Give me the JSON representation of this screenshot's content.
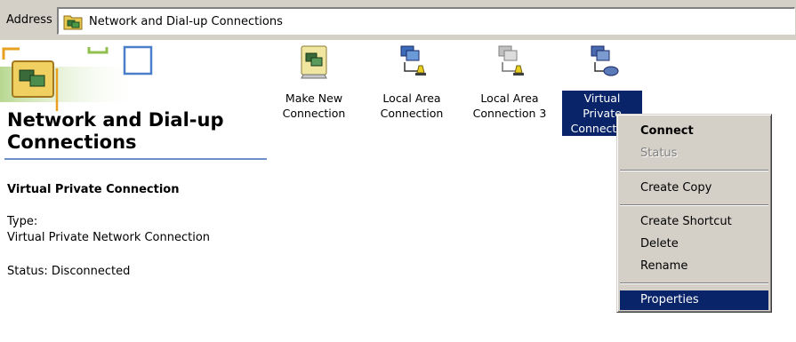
{
  "address_bar": {
    "label": "Address",
    "value": "Network and Dial-up Connections",
    "icon": "network-folder-icon"
  },
  "left_panel": {
    "title": "Network and Dial-up Connections",
    "selected_name": "Virtual Private Connection",
    "type_label": "Type:",
    "type_value": "Virtual Private Network Connection",
    "status": "Status: Disconnected"
  },
  "connections": [
    {
      "line1": "Make New",
      "line2": "Connection",
      "icon": "make-new-connection-icon",
      "selected": false
    },
    {
      "line1": "Local Area",
      "line2": "Connection",
      "icon": "lan-connection-icon",
      "selected": false
    },
    {
      "line1": "Local Area",
      "line2": "Connection 3",
      "icon": "lan-connection-disabled-icon",
      "selected": false
    },
    {
      "line1": "Virtual Private",
      "line2": "Connection",
      "icon": "vpn-connection-icon",
      "selected": true
    }
  ],
  "context_menu": {
    "items": [
      "Connect",
      "Status",
      "Create Copy",
      "Create Shortcut",
      "Delete",
      "Rename",
      "Properties"
    ],
    "default_item": "Connect",
    "disabled_item": "Status",
    "highlighted_item": "Properties"
  },
  "colors": {
    "selection": "#0a246a",
    "chrome": "#d4d0c8",
    "rule": "#6e90c8"
  }
}
